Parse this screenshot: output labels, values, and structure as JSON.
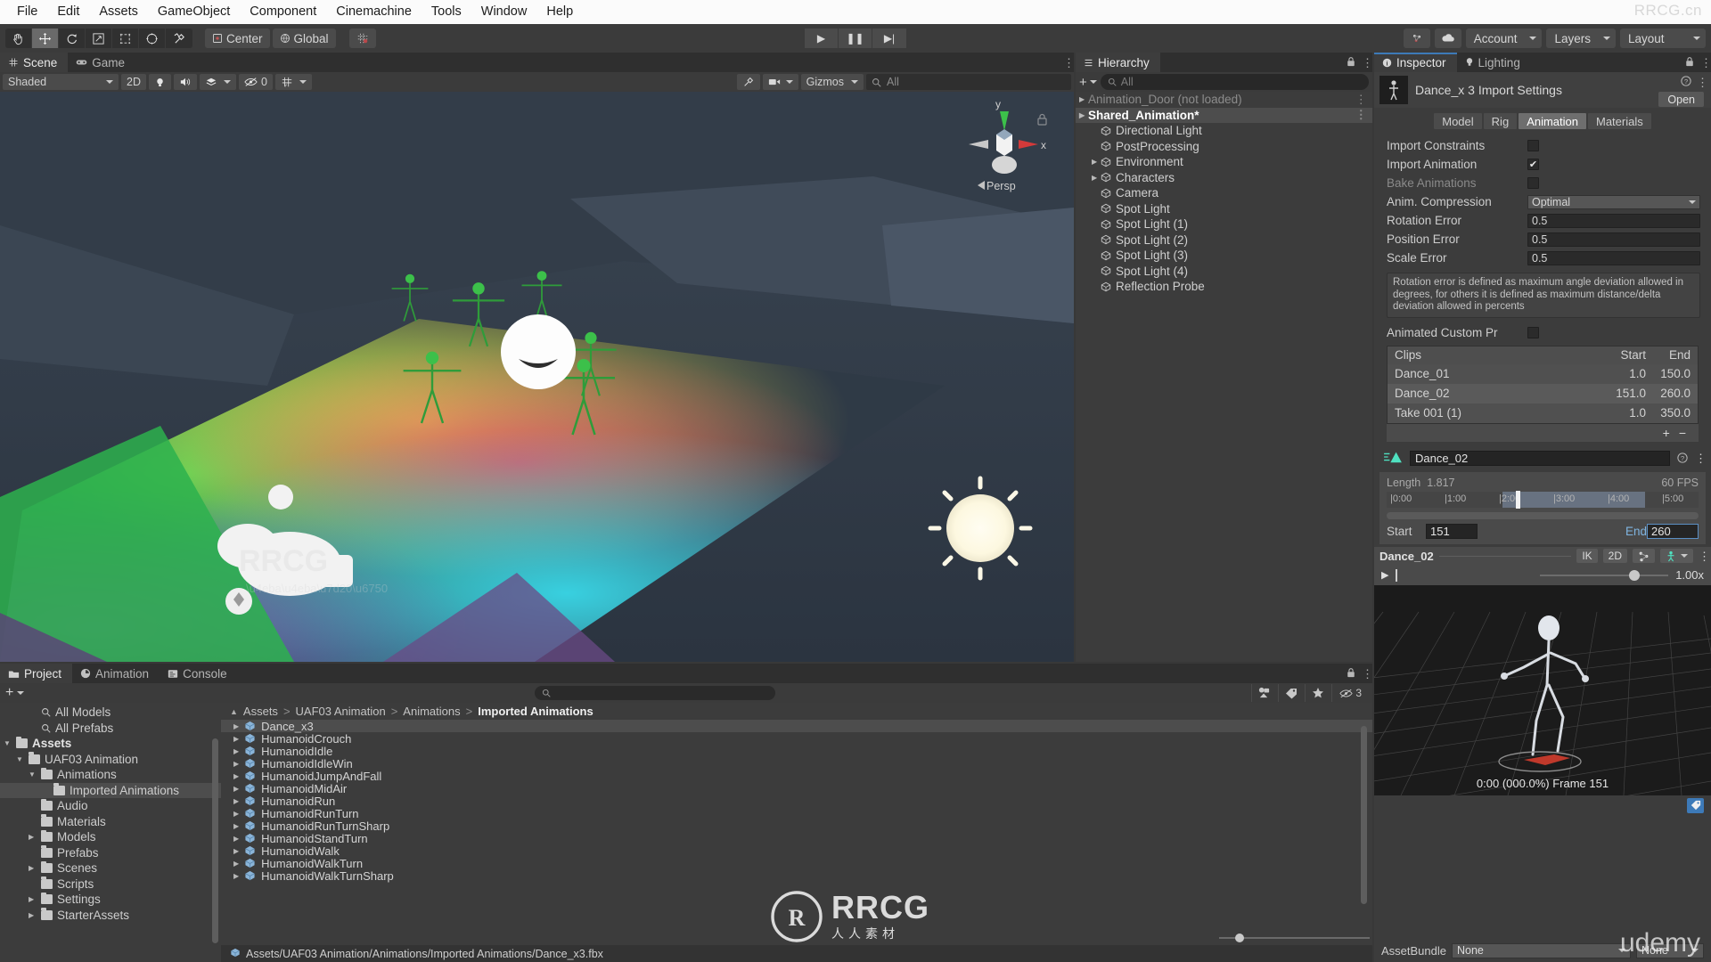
{
  "menu": {
    "items": [
      "File",
      "Edit",
      "Assets",
      "GameObject",
      "Component",
      "Cinemachine",
      "Tools",
      "Window",
      "Help"
    ],
    "brand": "RRCG.cn"
  },
  "toolbar": {
    "transform_tools": [
      "hand-tool",
      "move-tool",
      "rotate-tool",
      "scale-tool",
      "rect-tool",
      "transform-tool",
      "custom-tool"
    ],
    "pivot_label": "Center",
    "handle_label": "Global",
    "play": "▶",
    "pause": "❚❚",
    "step": "▶|",
    "account_label": "Account",
    "layers_label": "Layers",
    "layout_label": "Layout"
  },
  "scene": {
    "tabs": [
      {
        "label": "Scene",
        "icon": "grid-icon",
        "active": true
      },
      {
        "label": "Game",
        "icon": "gamepad-icon",
        "active": false
      }
    ],
    "draw_mode": "Shaded",
    "two_d": "2D",
    "audio_count": "0",
    "gizmos_label": "Gizmos",
    "search_placeholder": "All",
    "axis_x": "x",
    "axis_y": "y",
    "persp_label": "Persp"
  },
  "hierarchy": {
    "tab_label": "Hierarchy",
    "search_placeholder": "All",
    "items": [
      {
        "label": "Animation_Door (not loaded)",
        "indent": 0,
        "style": "dim",
        "arrow": true,
        "kebab": true
      },
      {
        "label": "Shared_Animation*",
        "indent": 0,
        "style": "selected",
        "arrow": true,
        "kebab": true
      },
      {
        "label": "Directional Light",
        "indent": 1,
        "style": "normal",
        "arrow": false,
        "kebab": false
      },
      {
        "label": "PostProcessing",
        "indent": 1,
        "style": "normal",
        "arrow": false,
        "kebab": false
      },
      {
        "label": "Environment",
        "indent": 1,
        "style": "normal",
        "arrow": true,
        "kebab": false
      },
      {
        "label": "Characters",
        "indent": 1,
        "style": "normal",
        "arrow": true,
        "kebab": false
      },
      {
        "label": "Camera",
        "indent": 1,
        "style": "normal",
        "arrow": false,
        "kebab": false
      },
      {
        "label": "Spot Light",
        "indent": 1,
        "style": "normal",
        "arrow": false,
        "kebab": false
      },
      {
        "label": "Spot Light (1)",
        "indent": 1,
        "style": "normal",
        "arrow": false,
        "kebab": false
      },
      {
        "label": "Spot Light (2)",
        "indent": 1,
        "style": "normal",
        "arrow": false,
        "kebab": false
      },
      {
        "label": "Spot Light (3)",
        "indent": 1,
        "style": "normal",
        "arrow": false,
        "kebab": false
      },
      {
        "label": "Spot Light (4)",
        "indent": 1,
        "style": "normal",
        "arrow": false,
        "kebab": false
      },
      {
        "label": "Reflection Probe",
        "indent": 1,
        "style": "normal",
        "arrow": false,
        "kebab": false
      }
    ]
  },
  "inspector": {
    "tabs": [
      {
        "label": "Inspector",
        "icon": "info-icon",
        "active": true
      },
      {
        "label": "Lighting",
        "icon": "bulb-icon",
        "active": false
      }
    ],
    "asset_title": "Dance_x 3 Import Settings",
    "open_button": "Open",
    "mode_tabs": [
      {
        "label": "Model",
        "active": false
      },
      {
        "label": "Rig",
        "active": false
      },
      {
        "label": "Animation",
        "active": true
      },
      {
        "label": "Materials",
        "active": false
      }
    ],
    "properties": [
      {
        "label": "Import Constraints",
        "type": "checkbox",
        "value": false,
        "disabled": false
      },
      {
        "label": "Import Animation",
        "type": "checkbox",
        "value": true,
        "disabled": false
      },
      {
        "label": "Bake Animations",
        "type": "checkbox",
        "value": false,
        "disabled": true
      },
      {
        "label": "Anim. Compression",
        "type": "dropdown",
        "value": "Optimal",
        "disabled": false
      },
      {
        "label": "Rotation Error",
        "type": "text",
        "value": "0.5",
        "disabled": false
      },
      {
        "label": "Position Error",
        "type": "text",
        "value": "0.5",
        "disabled": false
      },
      {
        "label": "Scale Error",
        "type": "text",
        "value": "0.5",
        "disabled": false
      }
    ],
    "help_text": "Rotation error is defined as maximum angle deviation allowed in degrees, for others it is defined as maximum distance/delta deviation allowed in percents",
    "custom_prop_label": "Animated Custom Pr",
    "clips_headers": [
      "Clips",
      "Start",
      "End"
    ],
    "clips": [
      {
        "name": "Dance_01",
        "start": "1.0",
        "end": "150.0"
      },
      {
        "name": "Dance_02",
        "start": "151.0",
        "end": "260.0"
      },
      {
        "name": "Take 001 (1)",
        "start": "1.0",
        "end": "350.0"
      }
    ],
    "clips_add": "+",
    "clips_remove": "−",
    "selected_clip_name": "Dance_02",
    "length_label": "Length",
    "length_value": "1.817",
    "fps_label": "60 FPS",
    "ruler_ticks": [
      "|0:00",
      "|1:00",
      "|2:00",
      "|3:00",
      "|4:00",
      "|5:00"
    ],
    "start_label": "Start",
    "start_value": "151",
    "end_label": "End",
    "end_value": "260",
    "anim_ctrl_name": "Dance_02",
    "ik_label": "IK",
    "twod_label": "2D",
    "preview_caption": "0:00 (000.0%) Frame 151",
    "speed_label": "1.00x",
    "assetbundle_label": "AssetBundle",
    "assetbundle_value": "None",
    "assetbundle_variant": "None"
  },
  "project": {
    "tabs": [
      {
        "label": "Project",
        "icon": "folder-icon",
        "active": true
      },
      {
        "label": "Animation",
        "icon": "clock-icon",
        "active": false
      },
      {
        "label": "Console",
        "icon": "console-icon",
        "active": false
      }
    ],
    "search_placeholder": "",
    "hidden_count": "3",
    "tree": [
      {
        "label": "All Models",
        "indent": 2,
        "type": "search",
        "expand": "none",
        "selected": false,
        "bold": false
      },
      {
        "label": "All Prefabs",
        "indent": 2,
        "type": "search",
        "expand": "none",
        "selected": false,
        "bold": false
      },
      {
        "label": "Assets",
        "indent": 0,
        "type": "folder",
        "expand": "open",
        "selected": false,
        "bold": true
      },
      {
        "label": "UAF03 Animation",
        "indent": 1,
        "type": "folder",
        "expand": "open",
        "selected": false,
        "bold": false
      },
      {
        "label": "Animations",
        "indent": 2,
        "type": "folder",
        "expand": "open",
        "selected": false,
        "bold": false
      },
      {
        "label": "Imported Animations",
        "indent": 3,
        "type": "folder",
        "expand": "none",
        "selected": true,
        "bold": false
      },
      {
        "label": "Audio",
        "indent": 2,
        "type": "folder",
        "expand": "none",
        "selected": false,
        "bold": false
      },
      {
        "label": "Materials",
        "indent": 2,
        "type": "folder",
        "expand": "none",
        "selected": false,
        "bold": false
      },
      {
        "label": "Models",
        "indent": 2,
        "type": "folder",
        "expand": "closed",
        "selected": false,
        "bold": false
      },
      {
        "label": "Prefabs",
        "indent": 2,
        "type": "folder",
        "expand": "none",
        "selected": false,
        "bold": false
      },
      {
        "label": "Scenes",
        "indent": 2,
        "type": "folder",
        "expand": "closed",
        "selected": false,
        "bold": false
      },
      {
        "label": "Scripts",
        "indent": 2,
        "type": "folder",
        "expand": "none",
        "selected": false,
        "bold": false
      },
      {
        "label": "Settings",
        "indent": 2,
        "type": "folder",
        "expand": "closed",
        "selected": false,
        "bold": false
      },
      {
        "label": "StarterAssets",
        "indent": 2,
        "type": "folder",
        "expand": "closed",
        "selected": false,
        "bold": false
      }
    ],
    "breadcrumb": [
      "Assets",
      "UAF03 Animation",
      "Animations",
      "Imported Animations"
    ],
    "assets": [
      {
        "label": "Dance_x3",
        "selected": true
      },
      {
        "label": "HumanoidCrouch",
        "selected": false
      },
      {
        "label": "HumanoidIdle",
        "selected": false
      },
      {
        "label": "HumanoidIdleWin",
        "selected": false
      },
      {
        "label": "HumanoidJumpAndFall",
        "selected": false
      },
      {
        "label": "HumanoidMidAir",
        "selected": false
      },
      {
        "label": "HumanoidRun",
        "selected": false
      },
      {
        "label": "HumanoidRunTurn",
        "selected": false
      },
      {
        "label": "HumanoidRunTurnSharp",
        "selected": false
      },
      {
        "label": "HumanoidStandTurn",
        "selected": false
      },
      {
        "label": "HumanoidWalk",
        "selected": false
      },
      {
        "label": "HumanoidWalkTurn",
        "selected": false
      },
      {
        "label": "HumanoidWalkTurnSharp",
        "selected": false
      }
    ],
    "path": "Assets/UAF03 Animation/Animations/Imported Animations/Dance_x3.fbx"
  },
  "watermarks": {
    "scene_logo": "RRCG",
    "scene_sub": "人人素材",
    "center_logo": "RRCG",
    "center_sub": "人人素材",
    "udemy": "udemy"
  },
  "colors": {
    "accent": "#3d7ab8",
    "panel": "#3c3c3c",
    "toolbar": "#3b3b3b",
    "selection": "#4d4d4d",
    "teal": "#4fe0c0"
  }
}
